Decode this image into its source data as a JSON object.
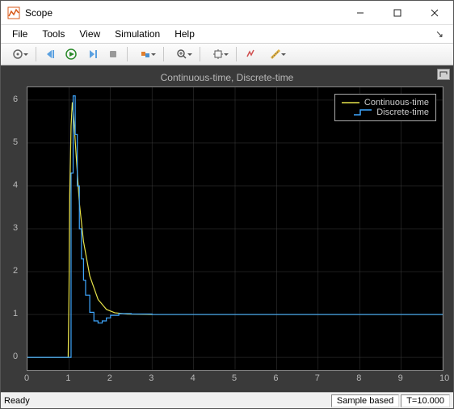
{
  "window": {
    "title": "Scope"
  },
  "menubar": {
    "items": [
      "File",
      "Tools",
      "View",
      "Simulation",
      "Help"
    ]
  },
  "statusbar": {
    "ready": "Ready",
    "mode": "Sample based",
    "time": "T=10.000"
  },
  "chart_data": {
    "type": "line",
    "title": "Continuous-time, Discrete-time",
    "xlabel": "",
    "ylabel": "",
    "xlim": [
      0,
      10
    ],
    "ylim": [
      -0.3,
      6.3
    ],
    "xticks": [
      0,
      1,
      2,
      3,
      4,
      5,
      6,
      7,
      8,
      9,
      10
    ],
    "yticks": [
      0,
      1,
      2,
      3,
      4,
      5,
      6
    ],
    "legend_position": "top-right",
    "series": [
      {
        "name": "Continuous-time",
        "color": "#e6e24a",
        "x": [
          0,
          0.98,
          1.0,
          1.02,
          1.05,
          1.08,
          1.12,
          1.18,
          1.25,
          1.35,
          1.5,
          1.7,
          1.9,
          2.1,
          2.4,
          3.0,
          4.0,
          10.0
        ],
        "y": [
          0,
          0,
          1.5,
          3.8,
          5.4,
          5.95,
          5.5,
          4.6,
          3.6,
          2.7,
          1.9,
          1.35,
          1.12,
          1.04,
          1.01,
          1.0,
          1.0,
          1.0
        ]
      },
      {
        "name": "Discrete-time",
        "color": "#3fa7ff",
        "step": true,
        "x": [
          0,
          1.0,
          1.05,
          1.1,
          1.15,
          1.2,
          1.25,
          1.3,
          1.35,
          1.4,
          1.5,
          1.6,
          1.7,
          1.8,
          1.9,
          2.0,
          2.2,
          2.5,
          3.0,
          10.0
        ],
        "y": [
          0,
          0,
          4.3,
          6.1,
          5.2,
          4.0,
          3.0,
          2.3,
          1.8,
          1.45,
          1.05,
          0.85,
          0.8,
          0.85,
          0.92,
          0.98,
          1.02,
          1.01,
          1.0,
          1.0
        ]
      }
    ]
  },
  "colors": {
    "plot_bg": "#000000",
    "panel_bg": "#3a3a3a",
    "grid": "#3c3c3c",
    "tick": "#b8b8b8"
  }
}
